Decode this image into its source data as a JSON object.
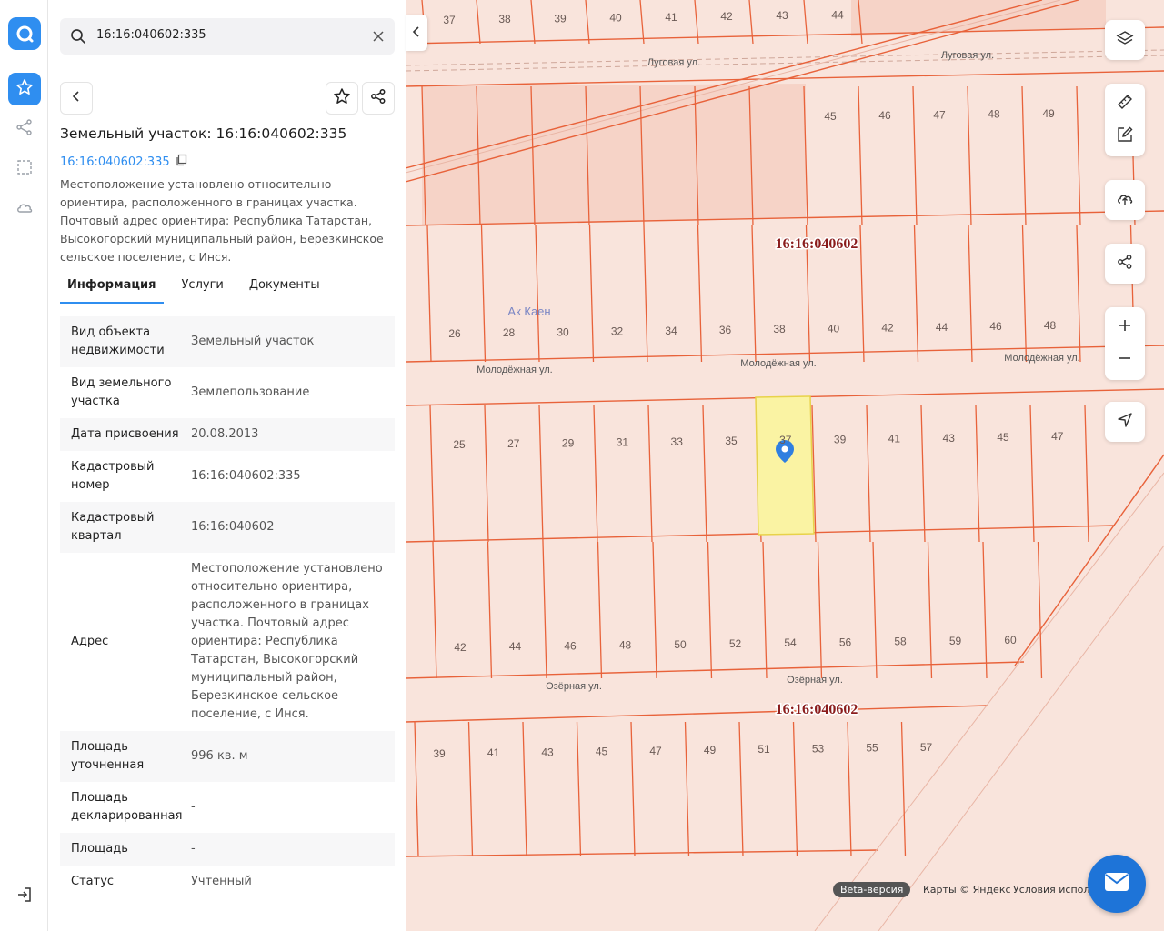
{
  "search": {
    "query": "16:16:040602:335"
  },
  "object": {
    "title": "Земельный участок: 16:16:040602:335",
    "cadastral_link": "16:16:040602:335",
    "description": "Местоположение установлено относительно ориентира, расположенного в границах участка. Почтовый адрес ориентира: Республика Татарстан, Высокогорский муниципальный район, Березкинское сельское поселение, с Инся."
  },
  "tabs": [
    "Информация",
    "Услуги",
    "Документы"
  ],
  "info": [
    {
      "key": "Вид объекта недвижимости",
      "value": "Земельный участок"
    },
    {
      "key": "Вид земельного участка",
      "value": "Землепользование"
    },
    {
      "key": "Дата присвоения",
      "value": "20.08.2013"
    },
    {
      "key": "Кадастровый номер",
      "value": "16:16:040602:335"
    },
    {
      "key": "Кадастровый квартал",
      "value": "16:16:040602"
    },
    {
      "key": "Адрес",
      "value": "Местоположение установлено относительно ориентира, расположенного в границах участка. Почтовый адрес ориентира: Республика Татарстан, Высокогорский муниципальный район, Березкинское сельское поселение, с Инся."
    },
    {
      "key": "Площадь уточненная",
      "value": "996 кв. м"
    },
    {
      "key": "Площадь декларированная",
      "value": "-"
    },
    {
      "key": "Площадь",
      "value": "-"
    },
    {
      "key": "Статус",
      "value": "Учтенный"
    }
  ],
  "map": {
    "streets": [
      {
        "label": "Луговая ул."
      },
      {
        "label": "Луговая ул."
      },
      {
        "label": "Молодёжная ул."
      },
      {
        "label": "Молодёжная ул."
      },
      {
        "label": "Молодёжная ул."
      },
      {
        "label": "Озёрная ул."
      },
      {
        "label": "Озёрная ул."
      }
    ],
    "place_label": "Ак Каен",
    "quarter_labels": [
      "16:16:040602",
      "16:16:040602"
    ],
    "rows": [
      {
        "lots": [
          "37",
          "38",
          "39",
          "40",
          "41",
          "42",
          "43",
          "44"
        ]
      },
      {
        "lots": [
          "45",
          "46",
          "47",
          "48",
          "49"
        ]
      },
      {
        "lots": [
          "26",
          "28",
          "30",
          "32",
          "34",
          "36",
          "38",
          "40",
          "42",
          "44",
          "46",
          "48"
        ]
      },
      {
        "lots": [
          "25",
          "27",
          "29",
          "31",
          "33",
          "35",
          "37",
          "39",
          "41",
          "43",
          "45",
          "47"
        ]
      },
      {
        "lots": [
          "42",
          "44",
          "46",
          "48",
          "50",
          "52",
          "54",
          "56",
          "58",
          "59",
          "60"
        ]
      },
      {
        "lots": [
          "39",
          "41",
          "43",
          "45",
          "47",
          "49",
          "51",
          "53",
          "55",
          "57"
        ]
      }
    ],
    "colors": {
      "parcel_line": "#e8623a",
      "parcel_fill": "#f9e4dc",
      "selected": "#faf3a3",
      "marker": "#2f7fe0",
      "quarter": "#8a1c1c"
    }
  },
  "footer": {
    "beta": "Beta-версия",
    "copyright": "Карты © Яндекс",
    "terms": "Условия испол"
  },
  "icons": {
    "rail": [
      "logo-icon",
      "star-icon",
      "route-icon",
      "select-area-icon",
      "cloud-icon",
      "logout-icon"
    ],
    "controls": [
      "layers-icon",
      "ruler-icon",
      "edit-icon",
      "upload-icon",
      "share-icon",
      "zoom-in-icon",
      "zoom-out-icon",
      "geolocation-icon"
    ]
  }
}
